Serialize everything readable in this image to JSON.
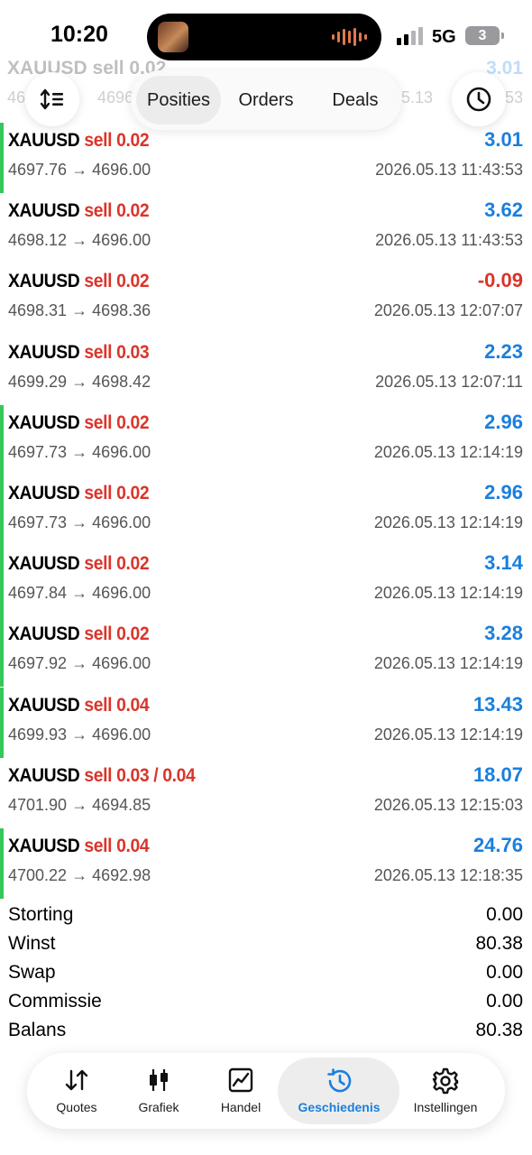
{
  "status_bar": {
    "time": "10:20",
    "network": "5G",
    "battery": "3"
  },
  "ghost_row": {
    "symbol": "XAUUSD sell 0.02",
    "prices": "46",
    "price_to": "4696",
    "profit": "3.01",
    "time": "6.05.13",
    "time_end": "53"
  },
  "tabs": [
    {
      "label": "Posities"
    },
    {
      "label": "Orders"
    },
    {
      "label": "Deals"
    }
  ],
  "deals": [
    {
      "symbol": "XAUUSD",
      "side": "sell",
      "volume": "0.02",
      "prices": "4697.76 → 4696.00",
      "time": "2026.05.13 11:43:53",
      "profit": "3.01",
      "marked": true
    },
    {
      "symbol": "XAUUSD",
      "side": "sell",
      "volume": "0.02",
      "prices": "4698.12 → 4696.00",
      "time": "2026.05.13 11:43:53",
      "profit": "3.62",
      "marked": false
    },
    {
      "symbol": "XAUUSD",
      "side": "sell",
      "volume": "0.02",
      "prices": "4698.31 → 4698.36",
      "time": "2026.05.13 12:07:07",
      "profit": "-0.09",
      "marked": false
    },
    {
      "symbol": "XAUUSD",
      "side": "sell",
      "volume": "0.03",
      "prices": "4699.29 → 4698.42",
      "time": "2026.05.13 12:07:11",
      "profit": "2.23",
      "marked": false
    },
    {
      "symbol": "XAUUSD",
      "side": "sell",
      "volume": "0.02",
      "prices": "4697.73 → 4696.00",
      "time": "2026.05.13 12:14:19",
      "profit": "2.96",
      "marked": true
    },
    {
      "symbol": "XAUUSD",
      "side": "sell",
      "volume": "0.02",
      "prices": "4697.73 → 4696.00",
      "time": "2026.05.13 12:14:19",
      "profit": "2.96",
      "marked": true
    },
    {
      "symbol": "XAUUSD",
      "side": "sell",
      "volume": "0.02",
      "prices": "4697.84 → 4696.00",
      "time": "2026.05.13 12:14:19",
      "profit": "3.14",
      "marked": true
    },
    {
      "symbol": "XAUUSD",
      "side": "sell",
      "volume": "0.02",
      "prices": "4697.92 → 4696.00",
      "time": "2026.05.13 12:14:19",
      "profit": "3.28",
      "marked": true
    },
    {
      "symbol": "XAUUSD",
      "side": "sell",
      "volume": "0.04",
      "prices": "4699.93 → 4696.00",
      "time": "2026.05.13 12:14:19",
      "profit": "13.43",
      "marked": true
    },
    {
      "symbol": "XAUUSD",
      "side": "sell",
      "volume": "0.03 / 0.04",
      "prices": "4701.90 → 4694.85",
      "time": "2026.05.13 12:15:03",
      "profit": "18.07",
      "marked": false
    },
    {
      "symbol": "XAUUSD",
      "side": "sell",
      "volume": "0.04",
      "prices": "4700.22 → 4692.98",
      "time": "2026.05.13 12:18:35",
      "profit": "24.76",
      "marked": true
    }
  ],
  "summary": [
    {
      "label": "Storting",
      "value": "0.00"
    },
    {
      "label": "Winst",
      "value": "80.38"
    },
    {
      "label": "Swap",
      "value": "0.00"
    },
    {
      "label": "Commissie",
      "value": "0.00"
    },
    {
      "label": "Balans",
      "value": "80.38"
    }
  ],
  "nav": [
    {
      "label": "Quotes",
      "icon": "quotes-arrows-icon"
    },
    {
      "label": "Grafiek",
      "icon": "candlestick-icon"
    },
    {
      "label": "Handel",
      "icon": "trade-chart-icon"
    },
    {
      "label": "Geschiedenis",
      "icon": "history-icon",
      "active": true
    },
    {
      "label": "Instellingen",
      "icon": "gear-icon"
    }
  ],
  "colors": {
    "accent_blue": "#1a7fde",
    "sell_red": "#d9352b",
    "marker_green": "#34c759"
  }
}
